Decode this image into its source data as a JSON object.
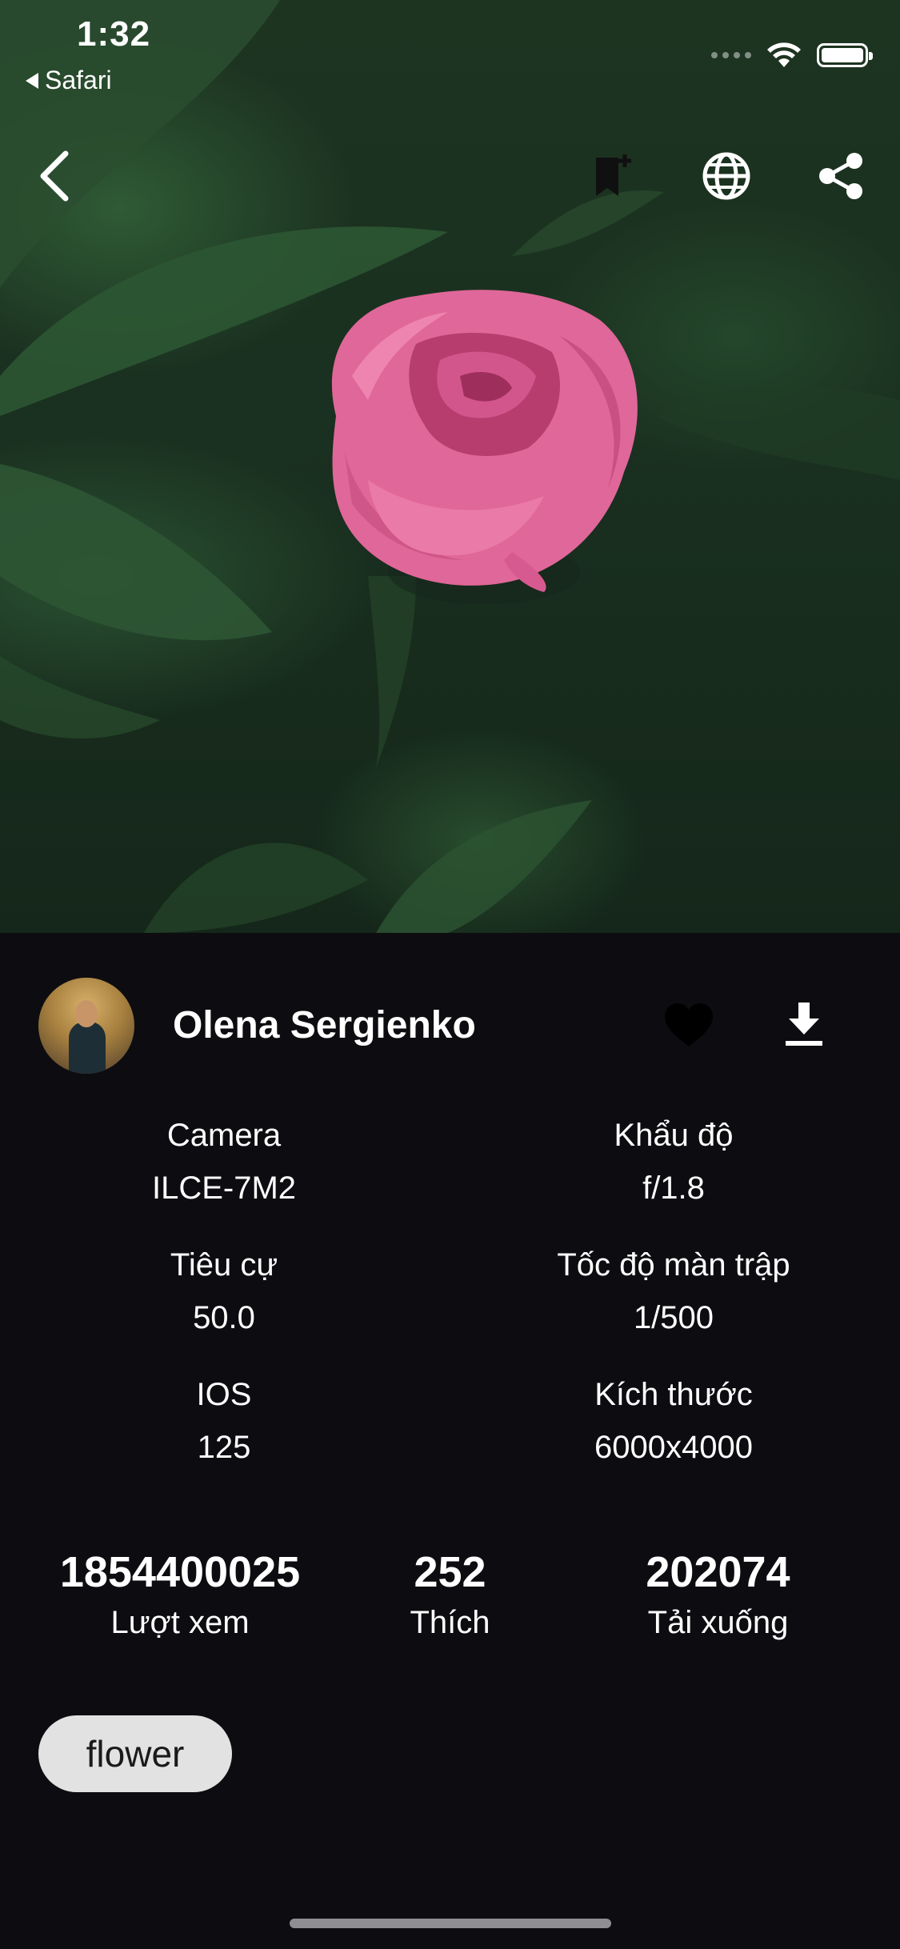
{
  "status_bar": {
    "time": "1:32",
    "back_app": "Safari",
    "icons": [
      "cellular-dots-icon",
      "wifi-icon",
      "battery-icon"
    ]
  },
  "nav": {
    "back_icon": "chevron-left-icon",
    "bookmark_icon": "bookmark-add-icon",
    "globe_icon": "globe-icon",
    "share_icon": "share-icon"
  },
  "photo": {
    "subject": "pink peony",
    "colors": {
      "flower": "#e2679a",
      "leaf": "#2f5a35",
      "background": "#1a3020"
    }
  },
  "author": {
    "name": "Olena Sergienko",
    "like_icon": "heart-icon",
    "download_icon": "download-icon"
  },
  "exif": [
    {
      "label": "Camera",
      "value": "ILCE-7M2"
    },
    {
      "label": "Khẩu độ",
      "value": "f/1.8"
    },
    {
      "label": "Tiêu cự",
      "value": "50.0"
    },
    {
      "label": "Tốc độ màn trập",
      "value": "1/500"
    },
    {
      "label": "IOS",
      "value": "125"
    },
    {
      "label": "Kích thước",
      "value": "6000x4000"
    }
  ],
  "stats": {
    "views": {
      "value": "1854400025",
      "label": "Lượt xem"
    },
    "likes": {
      "value": "252",
      "label": "Thích"
    },
    "downloads": {
      "value": "202074",
      "label": "Tải xuống"
    }
  },
  "tags": [
    "flower"
  ],
  "theme": {
    "panel_bg": "#0d0d11",
    "text": "#ffffff",
    "chip_bg": "#e2e2e2"
  }
}
